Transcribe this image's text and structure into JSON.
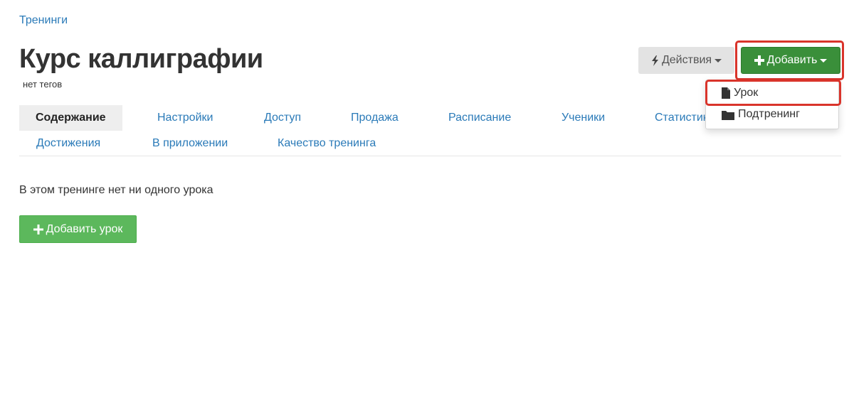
{
  "breadcrumb": "Тренинги",
  "header": {
    "title": "Курс каллиграфии",
    "tags_note": "нет тегов",
    "actions_label": "Действия",
    "add_label": "Добавить"
  },
  "add_menu": {
    "items": [
      {
        "label": "Урок",
        "icon": "file-icon"
      },
      {
        "label": "Подтренинг",
        "icon": "folder-icon"
      }
    ]
  },
  "tabs": [
    {
      "label": "Содержание",
      "active": true
    },
    {
      "label": "Настройки"
    },
    {
      "label": "Доступ"
    },
    {
      "label": "Продажа"
    },
    {
      "label": "Расписание"
    },
    {
      "label": "Ученики"
    },
    {
      "label": "Статистика"
    },
    {
      "label": "Достижения"
    },
    {
      "label": "В приложении"
    },
    {
      "label": "Качество тренинга"
    }
  ],
  "content": {
    "empty_text": "В этом тренинге нет ни одного урока",
    "add_lesson_label": "Добавить урок"
  },
  "colors": {
    "link": "#2a7ab8",
    "primary_green": "#3a8f3a",
    "success_green": "#5cb85c",
    "highlight_red": "#d9342b"
  }
}
